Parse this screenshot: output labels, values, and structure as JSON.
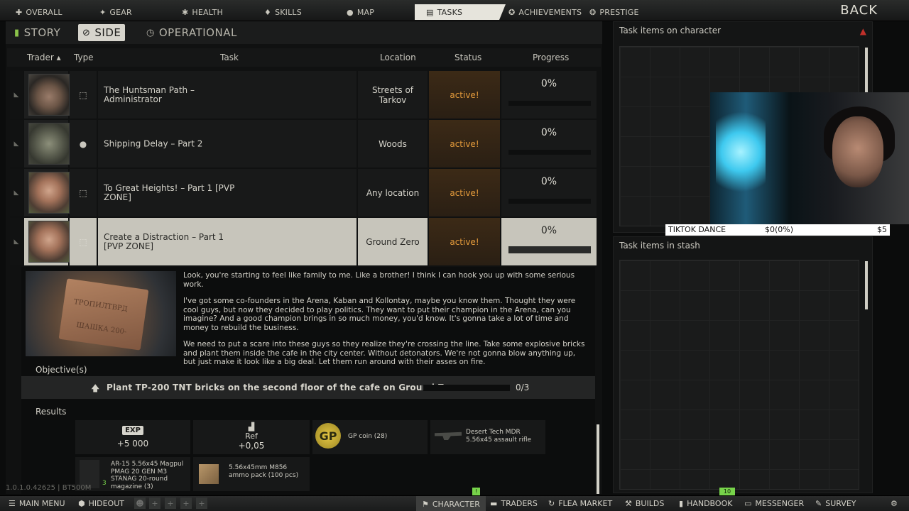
{
  "top_nav": {
    "tabs": [
      {
        "label": "OVERALL",
        "icon": "controller-icon"
      },
      {
        "label": "GEAR",
        "icon": "gear-icon"
      },
      {
        "label": "HEALTH",
        "icon": "health-icon"
      },
      {
        "label": "SKILLS",
        "icon": "skills-icon"
      },
      {
        "label": "MAP",
        "icon": "map-pin-icon"
      },
      {
        "label": "TASKS",
        "icon": "tasks-icon",
        "active": true
      },
      {
        "label": "ACHIEVEMENTS",
        "icon": "achievements-icon"
      },
      {
        "label": "PRESTIGE",
        "icon": "prestige-icon"
      }
    ],
    "back_label": "BACK"
  },
  "sub_tabs": [
    {
      "label": "STORY"
    },
    {
      "label": "SIDE",
      "active": true
    },
    {
      "label": "OPERATIONAL"
    }
  ],
  "table": {
    "headers": {
      "trader": "Trader",
      "sort": "▴",
      "type": "Type",
      "task": "Task",
      "location": "Location",
      "status": "Status",
      "progress": "Progress"
    },
    "rows": [
      {
        "task": "The Huntsman Path – Administrator",
        "location": "Streets of Tarkov",
        "status": "active!",
        "progress": "0%",
        "type_icon": "exit-icon",
        "trader": "jaeger-portrait"
      },
      {
        "task": "Shipping Delay – Part 2",
        "location": "Woods",
        "status": "active!",
        "progress": "0%",
        "type_icon": "location-pin-icon",
        "trader": "ragman-masked-portrait"
      },
      {
        "task": "To Great Heights! – Part 1 [PVP ZONE]",
        "location": "Any location",
        "status": "active!",
        "progress": "0%",
        "type_icon": "exit-icon",
        "trader": "prapor-portrait"
      },
      {
        "task": "Create a Distraction – Part 1 [PVP ZONE]",
        "location": "Ground Zero",
        "status": "active!",
        "progress": "0%",
        "type_icon": "exit-icon",
        "trader": "prapor-portrait",
        "selected": true
      }
    ]
  },
  "details": {
    "image_text_top": "ТРОПИЛТВРД",
    "image_text_bottom": "ШАШКА 200-",
    "paragraphs": [
      "Look, you're starting to feel like family to me. Like a brother! I think I can hook you up with some serious work.",
      "I've got some co-founders in the Arena, Kaban and Kollontay, maybe you know them. Thought they were cool guys, but now they decided to play politics. They want to put their champion in the Arena, can you imagine? And a good champion brings in so much money, you'd know. It's gonna take a lot of time and money to rebuild the business.",
      "We need to put a scare into these guys so they realize they're crossing the line. Take some explosive bricks and plant them inside the cafe in the city center. Without detonators. We're not gonna blow anything up, but just make it look like a big deal. Let them run around with their asses on fire."
    ],
    "objectives_label": "Objective(s)",
    "objective": {
      "text": "Plant TP-200 TNT bricks on the second floor of the cafe on Ground Zero",
      "count": "0/3",
      "progress": 0
    },
    "results_label": "Results",
    "rewards": {
      "exp_badge": "EXP",
      "exp_value": "+5 000",
      "ref_label": "Ref",
      "ref_value": "+0,05",
      "gp_icon_text": "GP",
      "gp_label": "GP coin (28)",
      "rifle_label": "Desert Tech MDR 5.56x45 assault rifle",
      "magazine_label": "AR-15 5.56x45 Magpul PMAG 20 GEN M3 STANAG 20-round magazine (3)",
      "magazine_count": "3",
      "ammo_label": "5.56x45mm M856 ammo pack (100 pcs)"
    }
  },
  "right": {
    "on_character_title": "Task items on character",
    "in_stash_title": "Task items in stash"
  },
  "overlay": {
    "name": "TIKTOK DANCE",
    "progress": "$0(0%)",
    "goal": "$5"
  },
  "version": "1.0.1.0.42625 | BT500M",
  "bottom_bar": {
    "main_menu": "MAIN MENU",
    "hideout": "HIDEOUT",
    "character": "CHARACTER",
    "traders": "TRADERS",
    "flea_market": "FLEA MARKET",
    "builds": "BUILDS",
    "handbook": "HANDBOOK",
    "messenger": "MESSENGER",
    "survey": "SURVEY",
    "character_badge": "!",
    "handbook_badge": "10"
  },
  "colors": {
    "status_active": "#e39a3b",
    "nav_active_bg": "#e6e4dc",
    "notif_green": "#77d34a"
  }
}
